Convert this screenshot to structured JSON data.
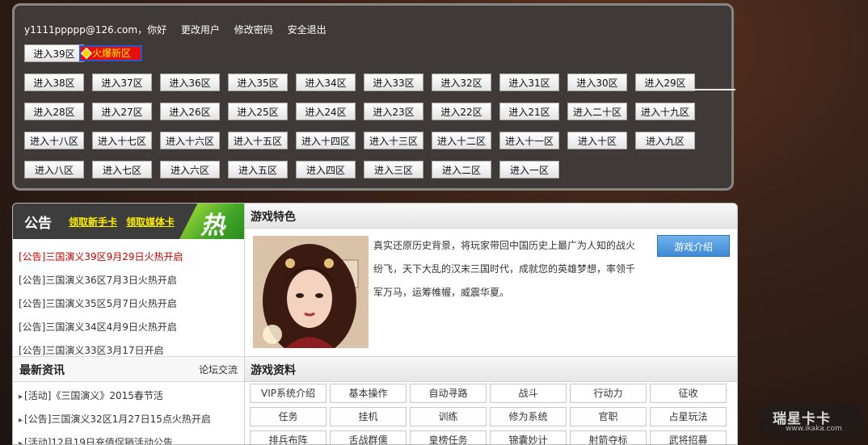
{
  "userbar": {
    "email_greeting": "y1111ppppp@126.com，你好",
    "change_user": "更改用户",
    "change_password": "修改密码",
    "logout": "安全退出"
  },
  "servers": {
    "latest": "进入39区",
    "hot_tag": "火爆新区",
    "rows": [
      [
        "进入38区",
        "进入37区",
        "进入36区",
        "进入35区",
        "进入34区",
        "进入33区",
        "进入32区",
        "进入31区",
        "进入30区",
        "进入29区"
      ],
      [
        "进入28区",
        "进入27区",
        "进入26区",
        "进入25区",
        "进入24区",
        "进入23区",
        "进入22区",
        "进入21区",
        "进入二十区",
        "进入十九区"
      ],
      [
        "进入十八区",
        "进入十七区",
        "进入十六区",
        "进入十五区",
        "进入十四区",
        "进入十三区",
        "进入十二区",
        "进入十一区",
        "进入十区",
        "进入九区"
      ],
      [
        "进入八区",
        "进入七区",
        "进入六区",
        "进入五区",
        "进入四区",
        "进入三区",
        "进入二区",
        "进入一区"
      ]
    ]
  },
  "notice": {
    "title": "公告",
    "link_newbie": "领取新手卡",
    "link_media": "领取媒体卡",
    "hot_badge": "热",
    "items": [
      "[公告]三国演义39区9月29日火热开启",
      "[公告]三国演义36区7月3日火热开启",
      "[公告]三国演义35区5月7日火热开启",
      "[公告]三国演义34区4月9日火热开启",
      "[公告]三国演义33区3月17日开启"
    ]
  },
  "news": {
    "title": "最新资讯",
    "forum": "论坛交流",
    "items": [
      "[活动]《三国演义》2015春节活",
      "[公告]三国演义32区1月27日15点火热开启",
      "[活动]12月19日充值促销活动公告"
    ]
  },
  "feature": {
    "title": "游戏特色",
    "description": "真实还原历史背景，将玩家带回中国历史上最广为人知的战火纷飞，天下大乱的汉末三国时代，成就您的英雄梦想，率领千军万马，运筹帷幄，威震华夏。",
    "intro_button": "游戏介绍"
  },
  "game_data": {
    "title": "游戏资料",
    "rows": [
      [
        "VIP系统介绍",
        "基本操作",
        "自动寻路",
        "战斗",
        "行动力",
        "征收"
      ],
      [
        "任务",
        "挂机",
        "训练",
        "修为系统",
        "官职",
        "占星玩法"
      ],
      [
        "排兵布阵",
        "舌战群儒",
        "皇榜任务",
        "锦囊妙计",
        "射箭夺标",
        "武将招募"
      ]
    ]
  },
  "watermark": {
    "main": "瑞星卡卡",
    "url": "www.ikaka.com"
  }
}
